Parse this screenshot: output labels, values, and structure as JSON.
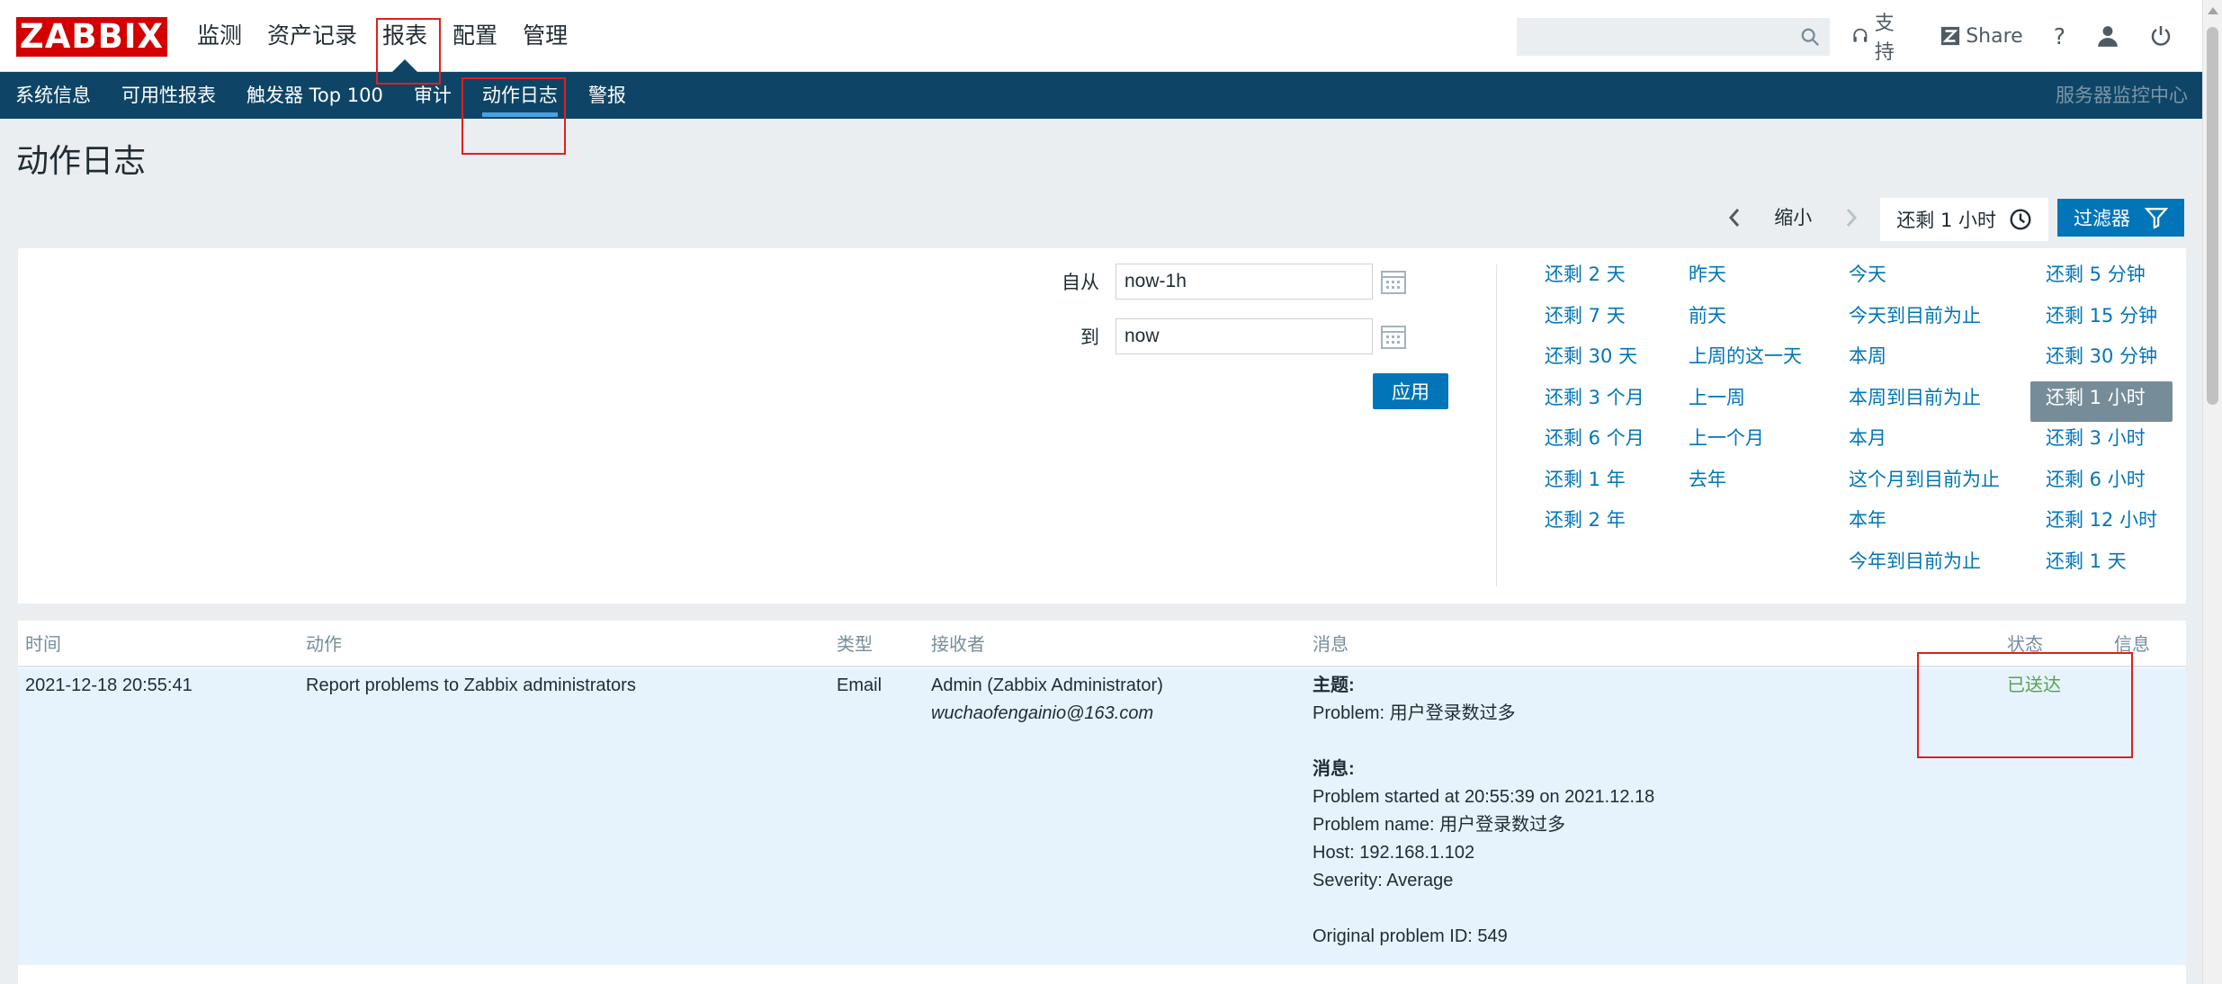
{
  "header": {
    "logo": "ZABBIX",
    "nav": [
      {
        "label": "监测"
      },
      {
        "label": "资产记录"
      },
      {
        "label": "报表"
      },
      {
        "label": "配置"
      },
      {
        "label": "管理"
      }
    ],
    "search_placeholder": "",
    "support_label": "支持",
    "share_label": "Share",
    "help_label": "?"
  },
  "subnav": {
    "items": [
      {
        "label": "系统信息"
      },
      {
        "label": "可用性报表"
      },
      {
        "label": "触发器 Top 100"
      },
      {
        "label": "审计"
      },
      {
        "label": "动作日志"
      },
      {
        "label": "警报"
      }
    ],
    "server_name": "服务器监控中心"
  },
  "page": {
    "title": "动作日志"
  },
  "filter_bar": {
    "zoom_out": "缩小",
    "time_tab": "还剩 1 小时",
    "filter_tab": "过滤器"
  },
  "filter_panel": {
    "from_label": "自从",
    "from_value": "now-1h",
    "to_label": "到",
    "to_value": "now",
    "apply_label": "应用",
    "quick_ranges": {
      "col1": [
        "还剩 2 天",
        "还剩 7 天",
        "还剩 30 天",
        "还剩 3 个月",
        "还剩 6 个月",
        "还剩 1 年",
        "还剩 2 年"
      ],
      "col2": [
        "昨天",
        "前天",
        "上周的这一天",
        "上一周",
        "上一个月",
        "去年"
      ],
      "col3": [
        "今天",
        "今天到目前为止",
        "本周",
        "本周到目前为止",
        "本月",
        "这个月到目前为止",
        "本年",
        "今年到目前为止"
      ],
      "col4": [
        "还剩 5 分钟",
        "还剩 15 分钟",
        "还剩 30 分钟",
        "还剩 1 小时",
        "还剩 3 小时",
        "还剩 6 小时",
        "还剩 12 小时",
        "还剩 1 天"
      ]
    },
    "selected_quick": "还剩 1 小时"
  },
  "table": {
    "headers": {
      "time": "时间",
      "action": "动作",
      "type": "类型",
      "recipient": "接收者",
      "message": "消息",
      "status": "状态",
      "info": "信息"
    },
    "rows": [
      {
        "time": "2021-12-18 20:55:41",
        "action": "Report problems to Zabbix administrators",
        "type": "Email",
        "recipient_name": "Admin (Zabbix Administrator)",
        "recipient_email": "wuchaofengainio@163.com",
        "subject_label": "主题:",
        "subject": "Problem: 用户登录数过多",
        "message_label": "消息:",
        "message_lines": [
          "Problem started at 20:55:39 on 2021.12.18",
          "Problem name: 用户登录数过多",
          "Host: 192.168.1.102",
          "Severity: Average",
          "",
          "Original problem ID: 549"
        ],
        "status": "已送达"
      }
    ]
  },
  "colors": {
    "brand_red": "#d40000",
    "nav_blue": "#0e4567",
    "link_blue": "#0275b8",
    "status_green": "#59a14f",
    "annotation_red": "#e0201c"
  }
}
